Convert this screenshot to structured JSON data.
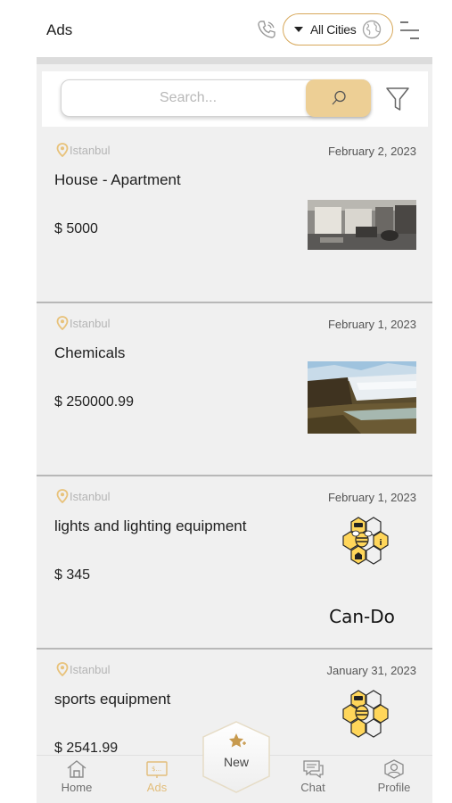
{
  "header": {
    "title": "Ads",
    "city_label": "All Cities",
    "icons": [
      "phone-icon",
      "globe-icon",
      "menu-icon"
    ]
  },
  "search": {
    "placeholder": "Search...",
    "icons": [
      "search-icon",
      "filter-icon"
    ]
  },
  "ads": [
    {
      "location": "Istanbul",
      "date": "February 2, 2023",
      "title": "House - Apartment",
      "price": "$ 5000",
      "image": "room-photo"
    },
    {
      "location": "Istanbul",
      "date": "February 1, 2023",
      "title": "Chemicals",
      "price": "$ 250000.99",
      "image": "waterfall-photo"
    },
    {
      "location": "Istanbul",
      "date": "February 1, 2023",
      "title": "lights and lighting equipment",
      "price": "$ 345",
      "image": "can-do-logo"
    },
    {
      "location": "Istanbul",
      "date": "January 31, 2023",
      "title": "sports equipment",
      "price": "$ 2541.99",
      "image": "can-do-logo"
    }
  ],
  "logo_text": "Can-Do",
  "nav": {
    "home": "Home",
    "ads": "Ads",
    "new": "New",
    "chat": "Chat",
    "profile": "Profile"
  },
  "colors": {
    "accent": "#e2bd7a",
    "search_button": "#edcf95",
    "panel_bg": "#f0f0f0",
    "hex_yellow": "#ffd65a"
  }
}
